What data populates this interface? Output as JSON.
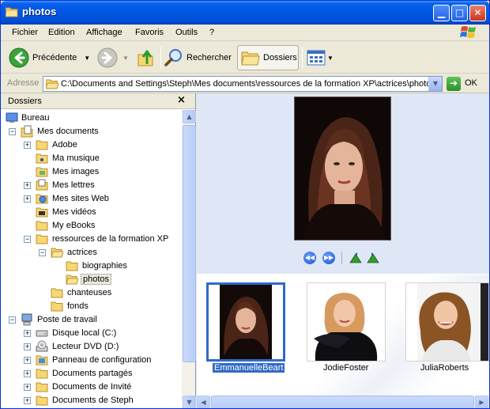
{
  "window": {
    "title": "photos"
  },
  "menu": [
    "Fichier",
    "Edition",
    "Affichage",
    "Favoris",
    "Outils",
    "?"
  ],
  "toolbar": {
    "back_label": "Précédente",
    "search_label": "Rechercher",
    "folders_label": "Dossiers"
  },
  "address": {
    "label": "Adresse",
    "path": "C:\\Documents and Settings\\Steph\\Mes documents\\ressources de la formation XP\\actrices\\photos",
    "go_label": "OK"
  },
  "folders_pane": {
    "title": "Dossiers",
    "close": "×",
    "tree": [
      {
        "label": "Bureau",
        "icon": "desktop-icon"
      },
      {
        "label": "Mes documents",
        "icon": "documents-folder-icon"
      },
      {
        "label": "Adobe",
        "icon": "folder-icon"
      },
      {
        "label": "Ma musique",
        "icon": "music-folder-icon"
      },
      {
        "label": "Mes images",
        "icon": "pictures-folder-icon"
      },
      {
        "label": "Mes lettres",
        "icon": "folder-icon"
      },
      {
        "label": "Mes sites Web",
        "icon": "web-folder-icon"
      },
      {
        "label": "Mes vidéos",
        "icon": "video-folder-icon"
      },
      {
        "label": "My eBooks",
        "icon": "folder-icon"
      },
      {
        "label": "ressources de la formation XP",
        "icon": "folder-icon"
      },
      {
        "label": "actrices",
        "icon": "open-folder-icon"
      },
      {
        "label": "biographies",
        "icon": "folder-icon"
      },
      {
        "label": "photos",
        "icon": "open-folder-icon"
      },
      {
        "label": "chanteuses",
        "icon": "folder-icon"
      },
      {
        "label": "fonds",
        "icon": "folder-icon"
      },
      {
        "label": "Poste de travail",
        "icon": "computer-icon"
      },
      {
        "label": "Disque local (C:)",
        "icon": "hard-drive-icon"
      },
      {
        "label": "Lecteur DVD (D:)",
        "icon": "dvd-drive-icon"
      },
      {
        "label": "Panneau de configuration",
        "icon": "control-panel-icon"
      },
      {
        "label": "Documents partagés",
        "icon": "folder-icon"
      },
      {
        "label": "Documents de Invité",
        "icon": "folder-icon"
      },
      {
        "label": "Documents de Steph",
        "icon": "folder-icon"
      }
    ]
  },
  "thumbnails": [
    {
      "caption": "EmmanuelleBeart",
      "selected": true
    },
    {
      "caption": "JodieFoster",
      "selected": false
    },
    {
      "caption": "JuliaRoberts",
      "selected": false
    }
  ],
  "colors": {
    "titlebar": "#0058e6",
    "selection": "#316ac5",
    "chrome": "#ece9d8"
  }
}
